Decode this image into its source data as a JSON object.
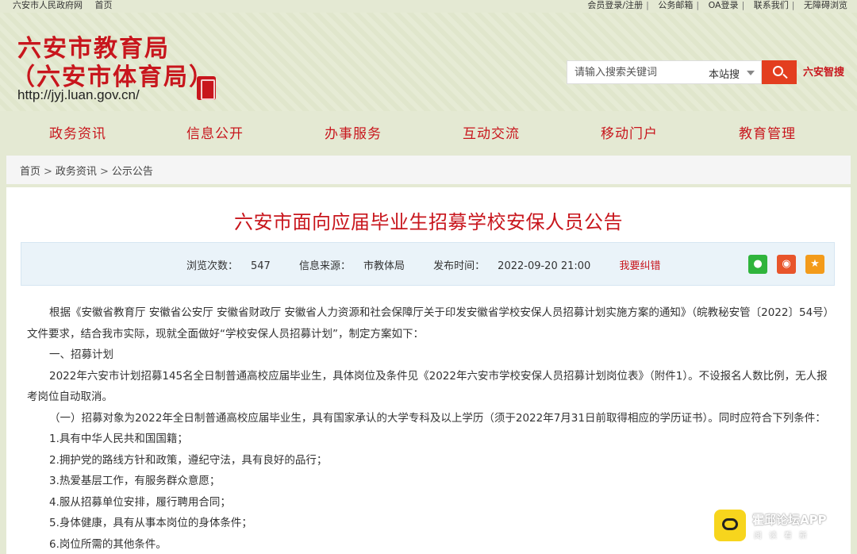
{
  "topbar": {
    "left": [
      "六安市人民政府网",
      "首页"
    ],
    "right": [
      "会员登录/注册",
      "公务邮箱",
      "OA登录",
      "联系我们",
      "无障碍浏览"
    ]
  },
  "header": {
    "title_line1": "六安市教育局",
    "title_line2": "（六安市体育局）",
    "url": "http://jyj.luan.gov.cn/",
    "search_placeholder": "请输入搜索关键词",
    "search_scope": "本站搜",
    "smart_search": "六安智搜"
  },
  "nav": [
    "政务资讯",
    "信息公开",
    "办事服务",
    "互动交流",
    "移动门户",
    "教育管理"
  ],
  "breadcrumb": [
    "首页",
    "政务资讯",
    "公示公告"
  ],
  "article": {
    "title": "六安市面向应届毕业生招募学校安保人员公告",
    "views_label": "浏览次数：",
    "views": "547",
    "source_label": "信息来源：",
    "source": "市教体局",
    "date_label": "发布时间：",
    "date": "2022-09-20 21:00",
    "correct": "我要纠错",
    "paragraphs": [
      "根据《安徽省教育厅 安徽省公安厅 安徽省财政厅 安徽省人力资源和社会保障厅关于印发安徽省学校安保人员招募计划实施方案的通知》（皖教秘安管〔2022〕54号）文件要求，结合我市实际，现就全面做好“学校安保人员招募计划”，制定方案如下：",
      "一、招募计划",
      "2022年六安市计划招募145名全日制普通高校应届毕业生，具体岗位及条件见《2022年六安市学校安保人员招募计划岗位表》（附件1）。不设报名人数比例，无人报考岗位自动取消。",
      "（一）招募对象为2022年全日制普通高校应届毕业生，具有国家承认的大学专科及以上学历（须于2022年7月31日前取得相应的学历证书）。同时应符合下列条件：",
      "1.具有中华人民共和国国籍；",
      "2.拥护党的路线方针和政策，遵纪守法，具有良好的品行；",
      "3.热爱基层工作，有服务群众意愿；",
      "4.服从招募单位安排，履行聘用合同；",
      "5.身体健康，具有从事本岗位的身体条件；",
      "6.岗位所需的其他条件。"
    ]
  },
  "watermark": {
    "title": "霍邱论坛APP",
    "sub": "阅读看新"
  },
  "icons": {
    "wechat": "wechat-icon",
    "weibo": "weibo-icon",
    "favorite": "star-icon",
    "search": "search-icon"
  }
}
